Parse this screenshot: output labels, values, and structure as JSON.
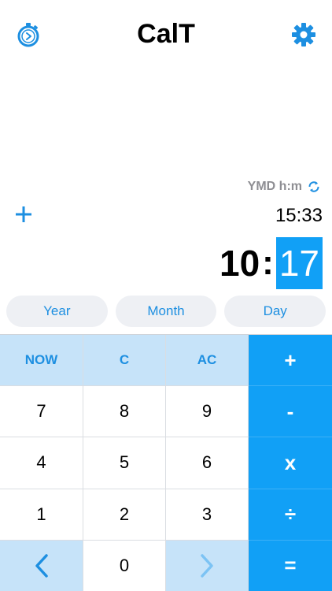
{
  "header": {
    "title": "CalT",
    "left_icon": "stopwatch-icon",
    "right_icon": "gear-icon"
  },
  "format": {
    "label": "YMD h:m",
    "icon": "refresh-icon"
  },
  "operation": {
    "icon": "plus-icon"
  },
  "previous_time": "15:33",
  "current_time": {
    "hours": "10",
    "separator": ":",
    "minutes": "17",
    "selected": "minutes"
  },
  "units": [
    "Year",
    "Month",
    "Day"
  ],
  "keypad": {
    "now": "NOW",
    "clear": "C",
    "all_clear": "AC",
    "plus": "+",
    "minus": "-",
    "multiply": "x",
    "divide": "÷",
    "equals": "=",
    "digits": [
      "7",
      "8",
      "9",
      "4",
      "5",
      "6",
      "1",
      "2",
      "3",
      "0"
    ],
    "left_icon": "chevron-left-icon",
    "right_icon": "chevron-right-icon"
  },
  "colors": {
    "accent": "#11a0f6",
    "accent_light": "#c6e3f9",
    "pill_bg": "#eef0f4",
    "muted_text": "#8e8e93"
  }
}
